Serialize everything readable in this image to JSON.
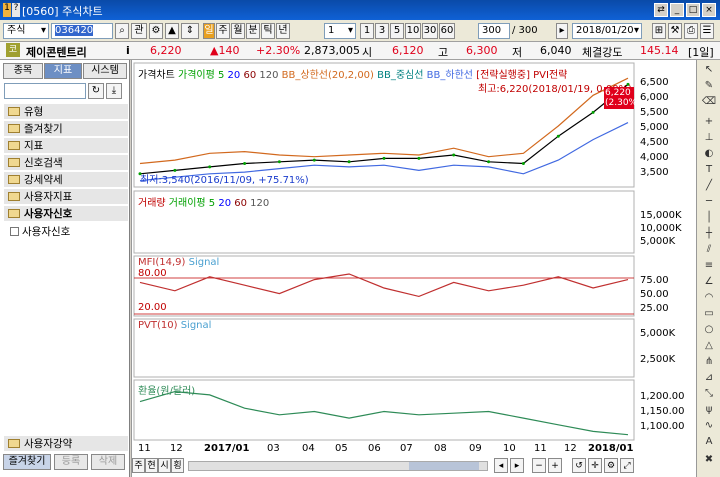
{
  "window": {
    "code": "[0560]",
    "title": "주식차트",
    "icon_labels": [
      "1",
      "?"
    ]
  },
  "toolbar": {
    "market": "주식",
    "stock_code": "036420",
    "btn_gwan": "관",
    "period_buttons": [
      "주",
      "월",
      "분",
      "틱",
      "년"
    ],
    "interval_value": "1",
    "interval_options": [
      "1",
      "3",
      "5",
      "10",
      "30",
      "60"
    ],
    "count_value": "300",
    "count_total": "/ 300",
    "date": "2018/01/20",
    "date_icon": "calendar-icon"
  },
  "quote": {
    "market_label": "코",
    "name": "제이콘텐트리",
    "info_label": "i",
    "price": "6,220",
    "change": "▲140",
    "change_pct": "+2.30%",
    "volume": "2,873,005",
    "open_label": "시",
    "open": "6,120",
    "high_label": "고",
    "high": "6,300",
    "low_label": "저",
    "low": "6,040",
    "strength_label": "체결강도",
    "strength": "145.14",
    "period_badge": "[1일]"
  },
  "sidebar": {
    "tabs": [
      "종목",
      "지표",
      "시스템"
    ],
    "active_tab": 1,
    "search_placeholder": "",
    "items": [
      "유형",
      "즐겨찾기",
      "지표",
      "신호검색",
      "강세약세",
      "사용자지표",
      "사용자신호"
    ],
    "subitem": "사용자신호",
    "bottom_item": "사용자강약",
    "bottom_tabs": [
      "즐겨찾기",
      "등록",
      "삭제"
    ]
  },
  "chart": {
    "price_legend": [
      "가격차트",
      "가격이평 5",
      "20",
      "60",
      "120",
      "BB_상한선(20,2,00)",
      "BB_중심선",
      "BB_하한선",
      "[전략실행중] PVI전략"
    ],
    "max_note": "최고:6,220(2018/01/19, 0.00%)",
    "min_note": "최저:3,540(2016/11/09, +75.71%)",
    "price_tag": "6,220",
    "price_tag_pct": "(2.30%)",
    "price_ticks": [
      "6,500",
      "6,000",
      "5,500",
      "5,000",
      "4,500",
      "4,000",
      "3,500"
    ],
    "volume_legend": [
      "거래량",
      "거래이평 5",
      "20",
      "60",
      "120"
    ],
    "volume_ticks": [
      "15,000K",
      "10,000K",
      "5,000K"
    ],
    "mfi_legend": [
      "MFI(14,9)",
      "Signal"
    ],
    "mfi_levels": [
      "80.00",
      "20.00"
    ],
    "mfi_ticks": [
      "75.00",
      "50.00",
      "25.00"
    ],
    "pvt_legend": [
      "PVT(10)",
      "Signal"
    ],
    "pvt_ticks": [
      "5,000K",
      "2,500K"
    ],
    "fx_legend": [
      "환율(원/달러)"
    ],
    "fx_ticks": [
      "1,200.00",
      "1,150.00",
      "1,100.00"
    ],
    "x_ticks": [
      "11",
      "12",
      "2017/01",
      "03",
      "04",
      "05",
      "06",
      "07",
      "08",
      "09",
      "10",
      "11",
      "12",
      "2018/01"
    ],
    "bottom_buttons": [
      "주",
      "현",
      "시",
      "횡"
    ],
    "colors": {
      "up": "#e0001b",
      "down": "#1a3ccc",
      "ma5": "#00a000",
      "ma20": "#0000ff",
      "ma60": "#8b0000",
      "bb_upper": "#d2691e",
      "bb_mid": "#008080",
      "bb_lower": "#4169e1",
      "mfi": "#c03030",
      "signal": "#4aa0d0",
      "fx": "#2e8b57"
    }
  },
  "chart_data": [
    {
      "type": "line",
      "title": "가격차트",
      "x": [
        "2016/11",
        "2016/12",
        "2017/01",
        "2017/02",
        "2017/03",
        "2017/04",
        "2017/05",
        "2017/06",
        "2017/07",
        "2017/08",
        "2017/09",
        "2017/10",
        "2017/11",
        "2017/12",
        "2018/01"
      ],
      "series": [
        {
          "name": "가격차트",
          "values": [
            3600,
            3700,
            3800,
            3900,
            3950,
            4000,
            3950,
            4050,
            4050,
            4150,
            3950,
            3900,
            4700,
            5400,
            6220
          ]
        },
        {
          "name": "BB_상한선(20,2,00)",
          "values": [
            3900,
            4000,
            4200,
            4250,
            4150,
            4100,
            4150,
            4200,
            4150,
            4350,
            4100,
            4200,
            5000,
            5900,
            6400
          ]
        },
        {
          "name": "BB_하한선",
          "values": [
            3400,
            3500,
            3600,
            3650,
            3750,
            3850,
            3800,
            3850,
            3700,
            3850,
            3800,
            3600,
            4000,
            4600,
            5100
          ]
        }
      ],
      "ylim": [
        3300,
        6700
      ]
    },
    {
      "type": "line",
      "title": "MFI(14,9)",
      "series": [
        {
          "name": "MFI(14,9)",
          "values": [
            60,
            45,
            70,
            55,
            40,
            65,
            75,
            50,
            35,
            60,
            45,
            55,
            70,
            50,
            65
          ]
        }
      ],
      "ylim": [
        0,
        100
      ]
    },
    {
      "type": "line",
      "title": "환율(원/달러)",
      "series": [
        {
          "name": "환율(원/달러)",
          "values": [
            1170,
            1200,
            1190,
            1150,
            1130,
            1140,
            1120,
            1140,
            1130,
            1135,
            1140,
            1120,
            1100,
            1080,
            1070
          ]
        }
      ],
      "ylim": [
        1060,
        1220
      ]
    }
  ]
}
